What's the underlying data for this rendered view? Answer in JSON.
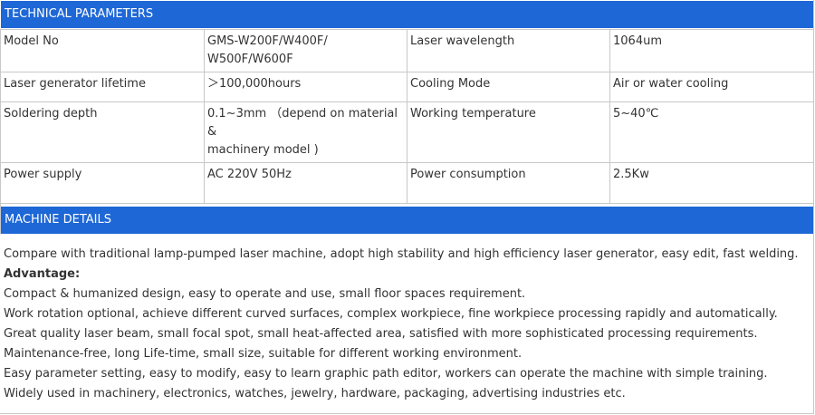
{
  "sections": {
    "technical_title": "TECHNICAL PARAMETERS",
    "details_title": "MACHINE DETAILS"
  },
  "params": [
    {
      "label1": "Model No",
      "value1_line1": "GMS-W200F/W400F/",
      "value1_line2": "W500F/W600F",
      "label2": "Laser wavelength",
      "value2": "1064um"
    },
    {
      "label1": "Laser generator lifetime",
      "value1": "＞100,000hours",
      "label2": "Cooling Mode",
      "value2": "Air or water cooling"
    },
    {
      "label1": "Soldering depth",
      "value1_line1": "0.1~3mm （depend on material &",
      "value1_line2": "machinery model )",
      "label2": "Working temperature",
      "value2": "5~40℃"
    },
    {
      "label1": "Power supply",
      "value1": "AC 220V 50Hz",
      "label2": "Power consumption",
      "value2": "2.5Kw"
    }
  ],
  "details": {
    "intro": "Compare with traditional lamp-pumped laser machine, adopt high stability and high efficiency laser generator, easy edit, fast welding.",
    "advantage_heading": "Advantage:",
    "items": [
      "Compact & humanized design, easy to operate and use, small floor spaces requirement.",
      "Work rotation optional, achieve different curved surfaces, complex workpiece, fine workpiece processing rapidly and automatically.",
      "Great quality laser beam, small focal spot, small heat-affected area, satisfied with more sophisticated processing requirements.",
      "Maintenance-free, long Life-time, small size, suitable for different working environment.",
      "Easy parameter setting, easy to modify, easy to learn graphic path editor, workers can operate the machine with simple training.",
      "Widely used in machinery, electronics, watches, jewelry, hardware, packaging, advertising industries etc."
    ]
  }
}
